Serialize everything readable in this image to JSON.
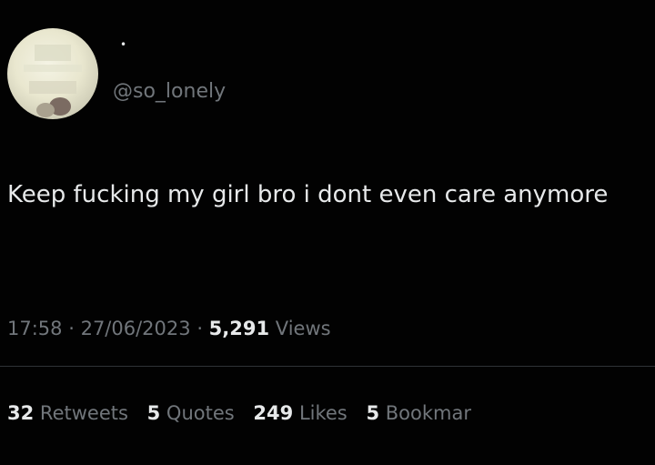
{
  "user": {
    "name_mark": "•",
    "handle": "@so_lonely",
    "avatar": "avatar-icon"
  },
  "tweet": {
    "text": "Keep fucking my girl bro i dont even care anymore",
    "time": "17:58",
    "date": "27/06/2023",
    "views_count": "5,291",
    "views_label": "Views"
  },
  "stats": {
    "retweets_count": "32",
    "retweets_label": "Retweets",
    "quotes_count": "5",
    "quotes_label": "Quotes",
    "likes_count": "249",
    "likes_label": "Likes",
    "bookmarks_count": "5",
    "bookmarks_label": "Bookmar"
  },
  "colors": {
    "background": "#000000",
    "primary_text": "#e7e9ea",
    "secondary_text": "#71767b",
    "divider": "#2f3336"
  }
}
